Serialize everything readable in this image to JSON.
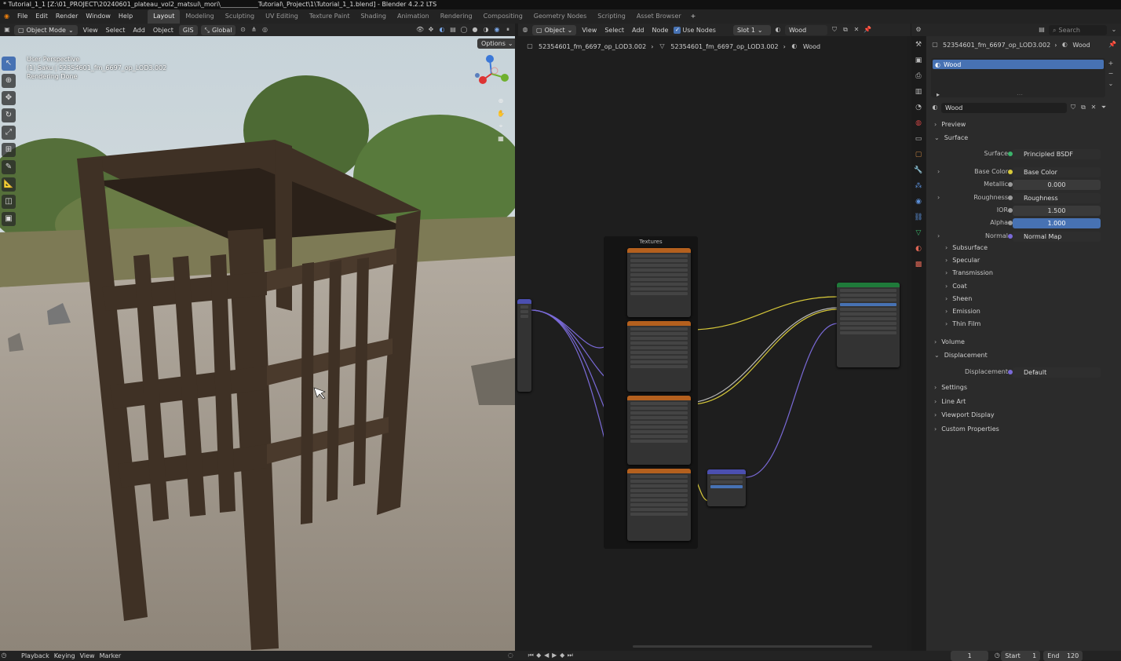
{
  "titlebar": {
    "text": "* Tutorial_1_1 [Z:\\01_PROJECT\\20240601_plateau_vol2_matsui\\_mori\\____________Tutorial\\_Project\\1\\Tutorial_1_1.blend] - Blender 4.2.2 LTS"
  },
  "menu": {
    "items": [
      "File",
      "Edit",
      "Render",
      "Window",
      "Help"
    ]
  },
  "workspaces": [
    "Layout",
    "Modeling",
    "Sculpting",
    "UV Editing",
    "Texture Paint",
    "Shading",
    "Animation",
    "Rendering",
    "Compositing",
    "Geometry Nodes",
    "Scripting",
    "Asset Browser"
  ],
  "workspace_active": "Layout",
  "viewport_header": {
    "mode": "Object Mode",
    "view": "View",
    "select": "Select",
    "add": "Add",
    "object": "Object",
    "gis": "GIS",
    "orientation": "Global",
    "options": "Options"
  },
  "viewport_overlay": {
    "line1": "User Perspective",
    "line2": "(1) Saku | 52354601_fm_6697_op_LOD3.002",
    "line3": "Rendering Done"
  },
  "node_header": {
    "type": "Object",
    "view": "View",
    "select": "Select",
    "add": "Add",
    "node": "Node",
    "use_nodes": "Use Nodes",
    "slot": "Slot 1",
    "material": "Wood"
  },
  "node_breadcrumb": {
    "object": "52354601_fm_6697_op_LOD3.002",
    "mesh": "52354601_fm_6697_op_LOD3.002",
    "material": "Wood"
  },
  "node_frame": {
    "label": "Textures"
  },
  "props_header": {
    "object": "52354601_fm_6697_op_LOD3.002",
    "material": "Wood",
    "search": "Search"
  },
  "material_slot": {
    "name": "Wood"
  },
  "material_name": "Wood",
  "props": {
    "preview": "Preview",
    "surface_section": "Surface",
    "surface_label": "Surface",
    "surface_value": "Principled BSDF",
    "base_color_label": "Base Color",
    "base_color_value": "Base Color",
    "metallic_label": "Metallic",
    "metallic_value": "0.000",
    "roughness_label": "Roughness",
    "roughness_value": "Roughness",
    "ior_label": "IOR",
    "ior_value": "1.500",
    "alpha_label": "Alpha",
    "alpha_value": "1.000",
    "normal_label": "Normal",
    "normal_value": "Normal Map",
    "subs": [
      "Subsurface",
      "Specular",
      "Transmission",
      "Coat",
      "Sheen",
      "Emission",
      "Thin Film"
    ],
    "volume": "Volume",
    "displacement_section": "Displacement",
    "displacement_label": "Displacement",
    "displacement_value": "Default",
    "settings": "Settings",
    "line_art": "Line Art",
    "viewport_display": "Viewport Display",
    "custom_props": "Custom Properties"
  },
  "timeline": {
    "playback": "Playback",
    "keying": "Keying",
    "view": "View",
    "marker": "Marker",
    "frame": "1",
    "start_label": "Start",
    "start": "1",
    "end_label": "End",
    "end": "120"
  },
  "colors": {
    "accent": "#4772b3",
    "wood": "#3f3125",
    "texture_node_header": "#b4601e",
    "bsdf_header": "#1f7a3a",
    "normal_header": "#4b4fb0",
    "link_yellow": "#d7c93a",
    "link_gray": "#b8b8b8",
    "link_purple": "#7a6ad8"
  }
}
